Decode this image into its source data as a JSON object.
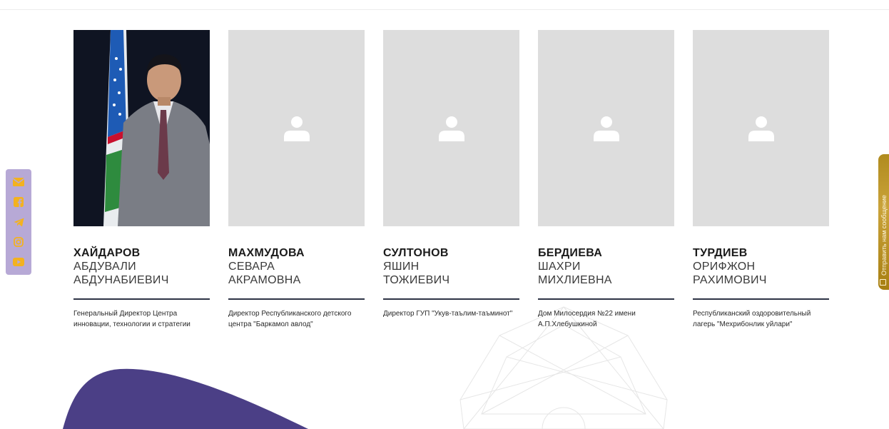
{
  "people": [
    {
      "surname": "ХАЙДАРОВ",
      "first_name": "АБДУВАЛИ",
      "patronymic": "АБДУНАБИЕВИЧ",
      "description": "Генеральный Директор Центра инновации, технологии и стратегии",
      "photo": "portrait"
    },
    {
      "surname": "МАХМУДОВА",
      "first_name": "СЕВАРА",
      "patronymic": "АКРАМОВНА",
      "description": "Директор Республиканского детского центра \"Баркамол авлод\"",
      "photo": "user-placeholder-icon"
    },
    {
      "surname": "СУЛТОНОВ",
      "first_name": "ЯШИН",
      "patronymic": "ТОЖИЕВИЧ",
      "description": "Директор ГУП \"Укув-таълим-таъминот\"",
      "photo": "user-placeholder-icon"
    },
    {
      "surname": "БЕРДИЕВА",
      "first_name": "ШАХРИ",
      "patronymic": "МИХЛИЕВНА",
      "description": "Дом Милосердия №22 имени А.П.Хлебушкиной",
      "photo": "user-placeholder-icon"
    },
    {
      "surname": "ТУРДИЕВ",
      "first_name": "ОРИФЖОН",
      "patronymic": "РАХИМОВИЧ",
      "description": "Республиканский оздоровительный лагерь \"Мехрибонлик уйлари\"",
      "photo": "user-placeholder-icon"
    }
  ],
  "social_bar": {
    "icons": [
      "mail-icon",
      "facebook-icon",
      "telegram-icon",
      "instagram-icon",
      "youtube-icon"
    ],
    "background": "#b7a9d6"
  },
  "feedback_tab": {
    "label": "Отправить нам сообщение",
    "icon": "message-icon"
  },
  "colors": {
    "accent_purple": "#4b3f86",
    "placeholder_gray": "#dddddd",
    "divider": "#2e3445",
    "gold": "#caa33a"
  }
}
